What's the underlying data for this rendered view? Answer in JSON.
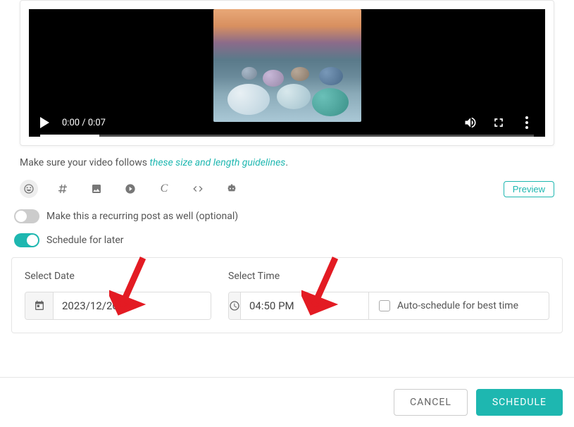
{
  "video": {
    "current_time": "0:00",
    "duration": "0:07",
    "time_display": "0:00 / 0:07"
  },
  "guidelines": {
    "prefix": "Make sure your video follows ",
    "link_text": "these size and length guidelines",
    "suffix": "."
  },
  "toolbar": {
    "preview_label": "Preview"
  },
  "toggles": {
    "recurring_label": "Make this a recurring post as well (optional)",
    "recurring_on": false,
    "schedule_later_label": "Schedule for later",
    "schedule_later_on": true
  },
  "schedule": {
    "date_label": "Select Date",
    "date_value": "2023/12/20",
    "time_label": "Select Time",
    "time_value": "04:50 PM",
    "auto_label": "Auto-schedule for best time",
    "auto_checked": false
  },
  "footer": {
    "cancel_label": "CANCEL",
    "schedule_label": "SCHEDULE"
  },
  "colors": {
    "accent": "#1eb7b0",
    "annotation": "#e31b23"
  }
}
